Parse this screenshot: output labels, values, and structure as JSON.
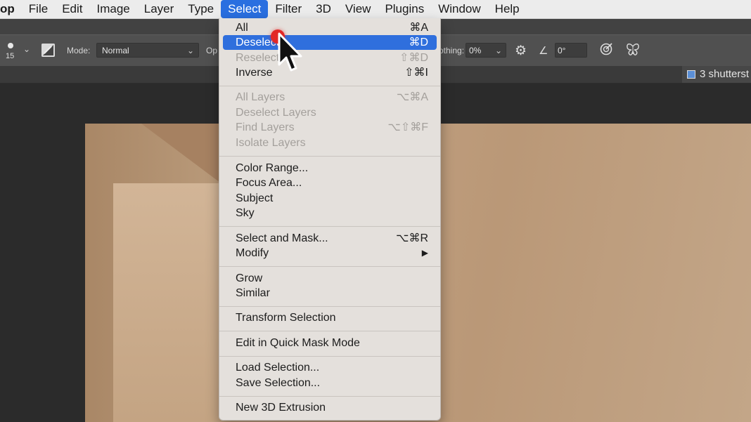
{
  "menubar": {
    "app_name": "op",
    "items": [
      "File",
      "Edit",
      "Image",
      "Layer",
      "Type",
      "Select",
      "Filter",
      "3D",
      "View",
      "Plugins",
      "Window",
      "Help"
    ],
    "active": "Select"
  },
  "options_bar": {
    "brush_size": "15",
    "mode_label": "Mode:",
    "mode_value": "Normal",
    "opacity_label_fragment": "Op",
    "smoothing_label_fragment": "othing:",
    "smoothing_value": "0%",
    "angle_value": "0°",
    "icons": [
      "brush-preset-icon",
      "toggle-brush-panel-icon",
      "gear-icon",
      "angle-icon",
      "pressure-icon",
      "symmetry-butterfly-icon"
    ]
  },
  "document_tab": {
    "title": "3 shutterst"
  },
  "select_menu": {
    "items": [
      {
        "label": "All",
        "shortcut": "⌘A",
        "disabled": false
      },
      {
        "label": "Deselect",
        "shortcut": "⌘D",
        "disabled": false,
        "highlighted": true
      },
      {
        "label": "Reselect",
        "shortcut": "⇧⌘D",
        "disabled": true
      },
      {
        "label": "Inverse",
        "shortcut": "⇧⌘I",
        "disabled": false
      },
      {
        "label": "All Layers",
        "shortcut": "⌥⌘A",
        "disabled": true
      },
      {
        "label": "Deselect Layers",
        "shortcut": "",
        "disabled": true
      },
      {
        "label": "Find Layers",
        "shortcut": "⌥⇧⌘F",
        "disabled": true
      },
      {
        "label": "Isolate Layers",
        "shortcut": "",
        "disabled": true
      },
      {
        "label": "Color Range...",
        "shortcut": "",
        "disabled": false
      },
      {
        "label": "Focus Area...",
        "shortcut": "",
        "disabled": false
      },
      {
        "label": "Subject",
        "shortcut": "",
        "disabled": false
      },
      {
        "label": "Sky",
        "shortcut": "",
        "disabled": false
      },
      {
        "label": "Select and Mask...",
        "shortcut": "⌥⌘R",
        "disabled": false
      },
      {
        "label": "Modify",
        "shortcut": "▶",
        "disabled": false
      },
      {
        "label": "Grow",
        "shortcut": "",
        "disabled": false
      },
      {
        "label": "Similar",
        "shortcut": "",
        "disabled": false
      },
      {
        "label": "Transform Selection",
        "shortcut": "",
        "disabled": false
      },
      {
        "label": "Edit in Quick Mask Mode",
        "shortcut": "",
        "disabled": false
      },
      {
        "label": "Load Selection...",
        "shortcut": "",
        "disabled": false
      },
      {
        "label": "Save Selection...",
        "shortcut": "",
        "disabled": false
      },
      {
        "label": "New 3D Extrusion",
        "shortcut": "",
        "disabled": false
      }
    ]
  },
  "colors": {
    "highlight": "#2f6fdd",
    "menubar_active": "#2a6fe0",
    "cursor_click_dot": "#e22826"
  }
}
